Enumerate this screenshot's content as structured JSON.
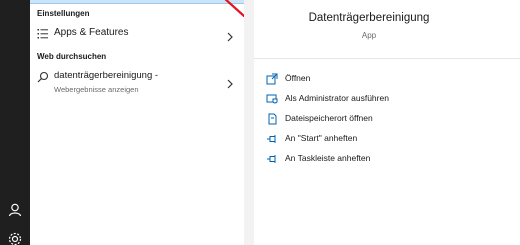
{
  "sections": {
    "settings_title": "Einstellungen",
    "web_title": "Web durchsuchen"
  },
  "results": {
    "apps_features": "Apps & Features",
    "web_query": "datenträgerbereinigung -",
    "web_sub": "Webergebnisse anzeigen"
  },
  "detail": {
    "title": "Datenträgerbereinigung",
    "type": "App",
    "actions": [
      {
        "label": "Öffnen",
        "icon": "open-icon"
      },
      {
        "label": "Als Administrator ausführen",
        "icon": "shield-icon"
      },
      {
        "label": "Dateispeicherort öffnen",
        "icon": "file-location-icon"
      },
      {
        "label": "An \"Start\" anheften",
        "icon": "pin-icon"
      },
      {
        "label": "An Taskleiste anheften",
        "icon": "pin-icon"
      }
    ]
  },
  "colors": {
    "accent": "#0063b1",
    "selection": "#cce4f7",
    "arrow": "#e81123"
  }
}
